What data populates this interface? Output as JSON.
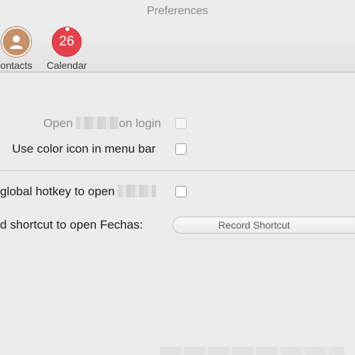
{
  "window": {
    "title": "Preferences"
  },
  "toolbar": {
    "items": [
      {
        "label": "Contacts",
        "visible_label": "ontacts",
        "icon": "contacts-icon"
      },
      {
        "label": "Calendar",
        "icon": "calendar-icon",
        "badge": "26"
      }
    ]
  },
  "general": {
    "open_on_login": {
      "label_start": "Open",
      "label_end": "on login",
      "checked": false,
      "enabled": false
    },
    "color_icon": {
      "label": "Use color icon in menu bar",
      "checked": false,
      "enabled": true
    }
  },
  "hotkey": {
    "global_hotkey": {
      "label": "global hotkey to open",
      "checked": false
    },
    "shortcut": {
      "label": "d shortcut to open Fechas:",
      "button": "Record Shortcut"
    }
  },
  "colors": {
    "background": "#ececec",
    "calendar_red": "#e8404a",
    "contacts_brown": "#c7916a"
  }
}
